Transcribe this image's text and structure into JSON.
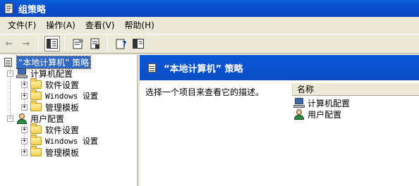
{
  "window": {
    "title": "组策略"
  },
  "menubar": {
    "items": [
      "文件(F)",
      "操作(A)",
      "查看(V)",
      "帮助(H)"
    ]
  },
  "toolbar": {
    "buttons": [
      "back-arrow",
      "forward-arrow",
      "show-hide-tree",
      "properties",
      "export-list",
      "help",
      "show-hide-action-pane"
    ]
  },
  "tree": {
    "root": "“本地计算机” 策略",
    "computer_config": {
      "label": "计算机配置",
      "children": [
        "软件设置",
        "Windows 设置",
        "管理模板"
      ]
    },
    "user_config": {
      "label": "用户配置",
      "children": [
        "软件设置",
        "Windows 设置",
        "管理模板"
      ]
    }
  },
  "details": {
    "header_title": "“本地计算机” 策略",
    "description": "选择一个项目来查看它的描述。",
    "column_name": "名称",
    "items": [
      "计算机配置",
      "用户配置"
    ]
  },
  "colors": {
    "titlebar": "#0a4fcf",
    "header": "#0a58d8",
    "selection": "#316ac5"
  }
}
